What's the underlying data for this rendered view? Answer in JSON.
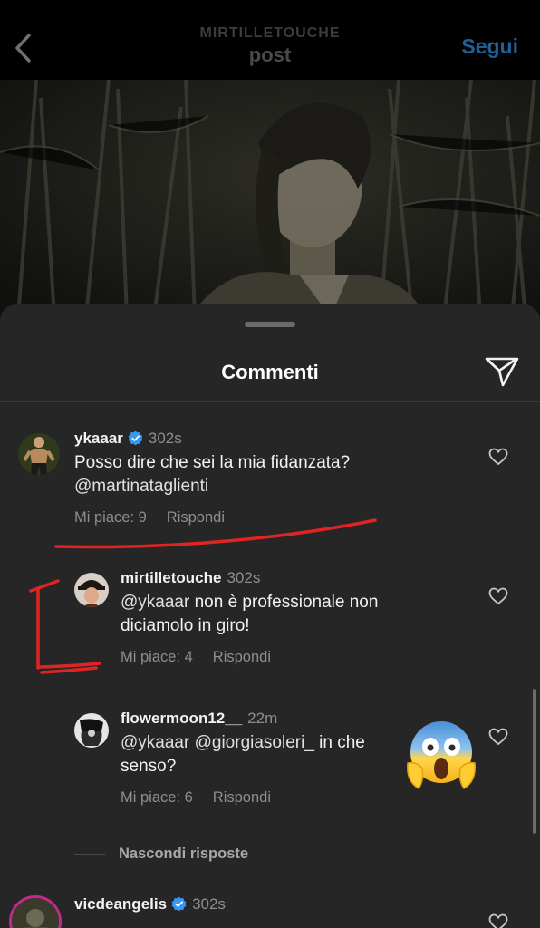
{
  "header": {
    "username": "MIRTILLETOUCHE",
    "title": "post",
    "follow_label": "Segui"
  },
  "sheet": {
    "title": "Commenti"
  },
  "comments": [
    {
      "username": "ykaaar",
      "verified": true,
      "time": "302s",
      "text": "Posso dire che sei la mia fidanzata?",
      "mention": "@martinataglienti",
      "likes_label": "Mi piace: 9",
      "reply_label": "Rispondi"
    }
  ],
  "replies": [
    {
      "username": "mirtilletouche",
      "time": "302s",
      "mention": "@ykaaar",
      "text": " non è professionale non diciamolo in giro!",
      "likes_label": "Mi piace: 4",
      "reply_label": "Rispondi"
    },
    {
      "username": "flowermoon12__",
      "time": "22m",
      "mention": "@ykaaar @giorgiasoleri_",
      "text": " in che senso?",
      "likes_label": "Mi piace: 6",
      "reply_label": "Rispondi"
    }
  ],
  "hide_replies_label": "Nascondi risposte",
  "next_comment": {
    "username": "vicdeangelis",
    "verified": true,
    "time": "302s"
  },
  "icons": [
    "back-chevron-icon",
    "paper-plane-icon",
    "heart-icon",
    "verified-badge-icon",
    "screaming-face-emoji"
  ],
  "colors": {
    "sheet_bg": "#262626",
    "verified": "#3897f0",
    "follow": "#1f5f97",
    "annotation_red": "#e02424",
    "secondary_text": "#8e8e8e"
  }
}
